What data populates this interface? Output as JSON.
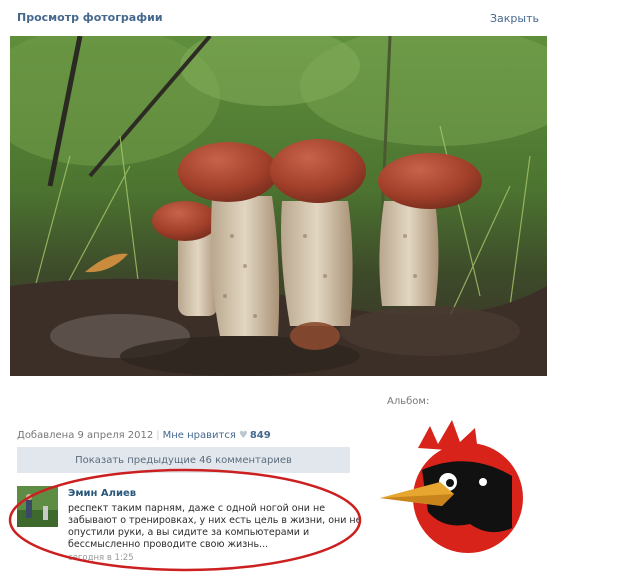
{
  "header": {
    "title": "Просмотр фотографии",
    "close_label": "Закрыть"
  },
  "sidebar": {
    "album_label": "Альбом:"
  },
  "meta": {
    "added_date": "Добавлена 9 апреля 2012",
    "likes_label": "Мне нравится",
    "likes_count": "849"
  },
  "comments": {
    "show_previous_label": "Показать предыдущие 46 комментариев",
    "items": [
      {
        "author": "Эмин Алиев",
        "text": "респект таким парням, даже с одной ногой они не забывают о тренировках, у них есть цель в жизни, они не опустили руки, а вы сидите за компьютерами и бессмысленно проводите свою жизнь...",
        "time": "сегодня в 1:25"
      }
    ]
  },
  "colors": {
    "link": "#45688e",
    "author_link": "#2b587a",
    "highlight_ellipse": "#cc2020",
    "mascot_red": "#d8231a"
  },
  "icons": {
    "like": "heart-icon",
    "mascot": "red-bird-mascot"
  }
}
